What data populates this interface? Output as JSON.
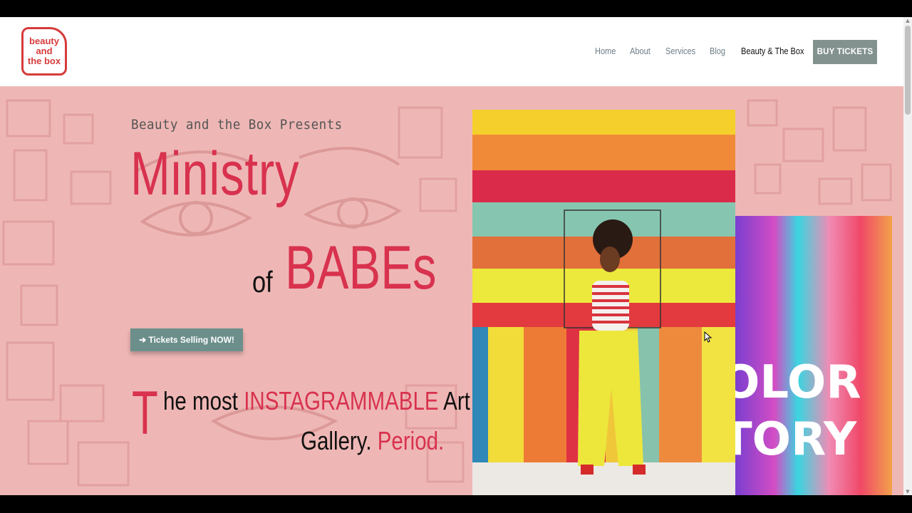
{
  "logo": {
    "line1": "beauty",
    "line2": "and",
    "line3": "the box"
  },
  "nav": {
    "items": [
      {
        "label": "Home"
      },
      {
        "label": "About"
      },
      {
        "label": "Services"
      },
      {
        "label": "Blog"
      },
      {
        "label": "Beauty & The Box",
        "active": true
      }
    ],
    "cta_label": "BUY TICKETS"
  },
  "hero": {
    "presents": "Beauty and the Box Presents",
    "title_line1": "Ministry",
    "title_of": "of",
    "title_line2": "BABEs",
    "button_label": "➔ Tickets Selling NOW!",
    "tagline": {
      "dropcap": "T",
      "part1": "he most ",
      "highlight1": "INSTAGRAMMABLE",
      "part2": " Art",
      "part3": "Gallery. ",
      "highlight2": "Period."
    },
    "side_image_text": {
      "line1": "OLOR",
      "line2": "TORY"
    }
  },
  "colors": {
    "accent_red": "#d8324e",
    "hero_bg": "#eeb7b5",
    "button_gray": "#83928f",
    "button_teal": "#6c8f8c"
  }
}
